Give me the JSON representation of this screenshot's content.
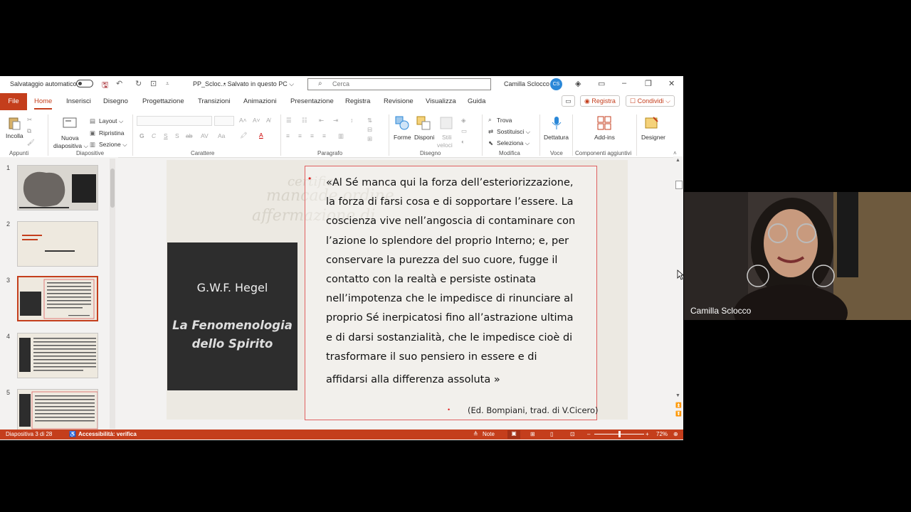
{
  "titlebar": {
    "autosave_label": "Salvataggio automatico",
    "filename": "PP_Scloc...",
    "save_status": "• Salvato in questo PC ⌵",
    "search_placeholder": "Cerca",
    "user_name": "Camilla Sclocco",
    "user_initials": "CS"
  },
  "tabs": {
    "file": "File",
    "items": [
      "Home",
      "Inserisci",
      "Disegno",
      "Progettazione",
      "Transizioni",
      "Animazioni",
      "Presentazione",
      "Registra",
      "Revisione",
      "Visualizza",
      "Guida"
    ],
    "record_button": "◉ Registra",
    "share_button": "☐ Condividi ⌵"
  },
  "ribbon": {
    "clipboard": {
      "paste": "Incolla",
      "group": "Appunti"
    },
    "slides": {
      "new_slide_1": "Nuova",
      "new_slide_2": "diapositiva ⌵",
      "layout": "Layout ⌵",
      "reset": "Ripristina",
      "section": "Sezione ⌵",
      "group": "Diapositive"
    },
    "font": {
      "group": "Carattere",
      "buttons": [
        "G",
        "C",
        "S",
        "S",
        "ab",
        "AV",
        "Aa"
      ]
    },
    "paragraph": {
      "group": "Paragrafo"
    },
    "drawing": {
      "shapes": "Forme",
      "arrange": "Disponi",
      "styles_1": "Stili",
      "styles_2": "veloci",
      "group": "Disegno"
    },
    "editing": {
      "find": "Trova",
      "replace": "Sostituisci ⌵",
      "select": "Seleziona ⌵",
      "group": "Modifica"
    },
    "voice": {
      "dictate": "Dettatura",
      "group": "Voce"
    },
    "addins": {
      "addins": "Add-ins",
      "group": "Componenti aggiuntivi"
    },
    "designer": {
      "label": "Designer"
    }
  },
  "thumbnails": {
    "numbers": [
      "1",
      "2",
      "3",
      "4",
      "5"
    ],
    "selected": 3
  },
  "slide": {
    "author": "G.W.F. Hegel",
    "work_line1": "La Fenomenologia",
    "work_line2": "dello Spirito",
    "quote_lines": [
      "«Al Sé manca qui la forza dell’esteriorizzazione,",
      "la forza di farsi cosa e di sopportare l’essere. La",
      "coscienza vive nell’angoscia di contaminare con",
      "l’azione lo splendore del proprio Interno; e, per",
      "conservare la purezza del suo cuore, fugge il",
      "contatto con la realtà e persiste ostinata",
      "nell’impotenza che le impedisce di rinunciare al",
      "proprio Sé inerpicatosi fino all’astrazione ultima",
      "e di darsi sostanzialità, che le impedisce cioè di",
      "trasformare il suo pensiero in essere e di",
      "affidarsi alla differenza assoluta »"
    ],
    "citation": "(Ed. Bompiani, trad. di V.Cicero)",
    "bullet": "•"
  },
  "statusbar": {
    "slide_info": "Diapositiva 3 di 28",
    "accessibility": "Accessibilità: verifica",
    "notes": "Note",
    "zoom": "72%",
    "zoom_fraction": 0.5
  },
  "webcam": {
    "participant": "Camilla Sclocco"
  },
  "colors": {
    "accent": "#c43e1c",
    "slide_dark": "#2d2d2d",
    "bullet_red": "#e01f1f"
  }
}
